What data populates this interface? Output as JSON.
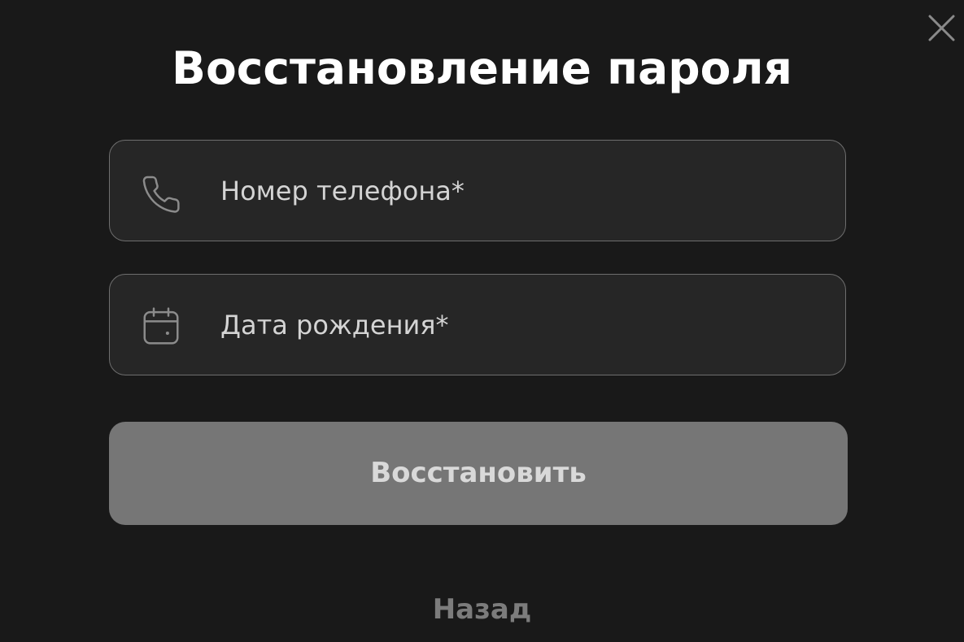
{
  "dialog": {
    "title": "Восстановление пароля",
    "close_icon": "close-icon"
  },
  "form": {
    "phone": {
      "icon": "phone-icon",
      "placeholder": "Номер телефона*",
      "value": ""
    },
    "birth_date": {
      "icon": "calendar-icon",
      "placeholder": "Дата рождения*",
      "value": ""
    },
    "submit_label": "Восстановить",
    "back_label": "Назад"
  },
  "colors": {
    "background": "#191919",
    "field_background": "#262626",
    "field_border": "#6e6e6e",
    "button_background": "#767676",
    "button_text": "#d9d9d9",
    "title_text": "#ffffff",
    "link_text": "#7c7c7c"
  }
}
